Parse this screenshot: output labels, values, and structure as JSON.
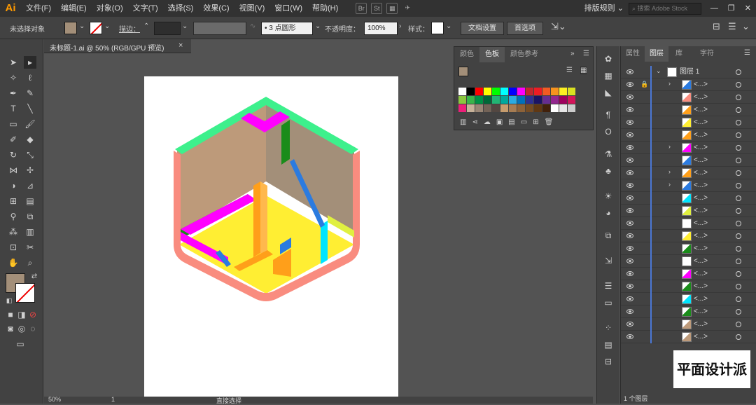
{
  "menubar": {
    "logo": "Ai",
    "items": [
      "文件(F)",
      "编辑(E)",
      "对象(O)",
      "文字(T)",
      "选择(S)",
      "效果(C)",
      "视图(V)",
      "窗口(W)",
      "帮助(H)"
    ],
    "br_icon": "Br",
    "st_icon": "St",
    "workspace": "排版规则",
    "search_placeholder": "搜索 Adobe Stock"
  },
  "control": {
    "selection": "未选择对象",
    "stroke_label": "描边：",
    "brush": "3 点圆形",
    "opacity_label": "不透明度：",
    "opacity_value": "100%",
    "style_label": "样式：",
    "doc_setup": "文档设置",
    "prefs": "首选项"
  },
  "doc_tab": {
    "title": "未标题-1.ai @ 50% (RGB/GPU 预览)",
    "close": "×"
  },
  "status": {
    "zoom": "50%",
    "page": "1",
    "tool": "直接选择"
  },
  "swatches": {
    "tabs": [
      "颜色",
      "色板",
      "颜色参考"
    ],
    "active_tab": "色板",
    "colors": [
      "#ffffff",
      "#000000",
      "#ff0000",
      "#ffff00",
      "#00ff00",
      "#00ffff",
      "#0000ff",
      "#ff00ff",
      "#c1272d",
      "#ed1c24",
      "#f15a24",
      "#f7931e",
      "#fcee21",
      "#d9e021",
      "#8cc63f",
      "#39b54a",
      "#009245",
      "#006837",
      "#22b573",
      "#00a99d",
      "#29abe2",
      "#0071bc",
      "#2e3192",
      "#1b1464",
      "#662d91",
      "#93278f",
      "#9e005d",
      "#d4145a",
      "#ed1e79",
      "#c7b299",
      "#998675",
      "#736357",
      "#534741",
      "#c69c6d",
      "#a67c52",
      "#8c6239",
      "#754c24",
      "#603813",
      "#42210b",
      "#ffffff",
      "#e6e6e6",
      "#cccccc"
    ]
  },
  "layers_panel": {
    "tabs": [
      "属性",
      "图层",
      "库",
      "字符"
    ],
    "active_tab": "图层",
    "layer_name": "图层 1",
    "sublayer_label": "<...>",
    "row_count": 22,
    "footer": "1 个图层"
  },
  "colors": {
    "fill": "#a38f79",
    "accent_green": "#3df08c",
    "salmon": "#f98c7f",
    "tan": "#bd9a7a",
    "magenta": "#ff00ff",
    "dark_green": "#1a8c1a",
    "orange": "#ff9f1a",
    "yellow": "#ffee33",
    "cyan": "#00e5ff",
    "blue_stair": "#2b7be0",
    "yellow_green": "#e0f040"
  },
  "watermark": "平面设计派"
}
